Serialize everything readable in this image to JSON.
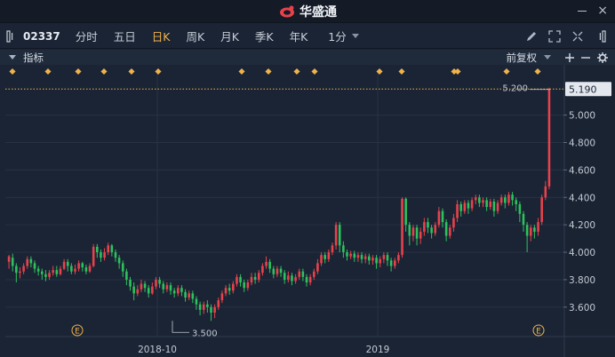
{
  "app": {
    "brand": "华盛通"
  },
  "toolbar": {
    "stock_code": "02337",
    "tabs": [
      {
        "label": "分时",
        "active": false
      },
      {
        "label": "五日",
        "active": false
      },
      {
        "label": "日K",
        "active": true
      },
      {
        "label": "周K",
        "active": false
      },
      {
        "label": "月K",
        "active": false
      },
      {
        "label": "季K",
        "active": false
      },
      {
        "label": "年K",
        "active": false
      }
    ],
    "interval": "1分"
  },
  "indicator_bar": {
    "label": "指标",
    "adjust": "前复权"
  },
  "colors": {
    "up": "#e8424b",
    "down": "#2ec25e",
    "accent": "#f0b24a",
    "background": "#1b2434"
  },
  "chart_data": {
    "type": "candlestick",
    "ylim": [
      3.45,
      5.25
    ],
    "y_ticks": [
      "5.190",
      "5.000",
      "4.800",
      "4.600",
      "4.400",
      "4.200",
      "4.000",
      "3.800",
      "3.600"
    ],
    "x_labels": [
      "2018-10",
      "2019"
    ],
    "last_price": "5.190",
    "max_label": "5.200",
    "min_label": "3.500",
    "event_markers": [
      "E",
      "E"
    ],
    "candles": [
      [
        3.93,
        3.97,
        3.88,
        3.98
      ],
      [
        3.96,
        3.9,
        3.86,
        3.99
      ],
      [
        3.9,
        3.85,
        3.78,
        3.92
      ],
      [
        3.85,
        3.86,
        3.81,
        3.89
      ],
      [
        3.86,
        3.9,
        3.84,
        3.92
      ],
      [
        3.9,
        3.95,
        3.88,
        3.97
      ],
      [
        3.95,
        3.92,
        3.89,
        3.97
      ],
      [
        3.92,
        3.88,
        3.85,
        3.94
      ],
      [
        3.88,
        3.86,
        3.83,
        3.9
      ],
      [
        3.86,
        3.84,
        3.8,
        3.88
      ],
      [
        3.84,
        3.82,
        3.79,
        3.87
      ],
      [
        3.82,
        3.85,
        3.8,
        3.87
      ],
      [
        3.85,
        3.87,
        3.83,
        3.9
      ],
      [
        3.87,
        3.84,
        3.82,
        3.9
      ],
      [
        3.84,
        3.88,
        3.83,
        3.9
      ],
      [
        3.88,
        3.93,
        3.87,
        3.95
      ],
      [
        3.93,
        3.9,
        3.86,
        3.95
      ],
      [
        3.9,
        3.86,
        3.84,
        3.92
      ],
      [
        3.86,
        3.88,
        3.84,
        3.91
      ],
      [
        3.88,
        3.92,
        3.86,
        3.94
      ],
      [
        3.92,
        3.89,
        3.86,
        3.93
      ],
      [
        3.89,
        3.86,
        3.84,
        3.91
      ],
      [
        3.86,
        3.9,
        3.85,
        3.92
      ],
      [
        3.9,
        4.04,
        3.89,
        4.06
      ],
      [
        4.04,
        4.0,
        3.96,
        4.06
      ],
      [
        4.0,
        3.96,
        3.93,
        4.02
      ],
      [
        3.96,
        4.0,
        3.94,
        4.03
      ],
      [
        4.0,
        4.05,
        3.98,
        4.07
      ],
      [
        4.05,
        4.0,
        3.97,
        4.06
      ],
      [
        4.0,
        3.96,
        3.93,
        4.02
      ],
      [
        3.96,
        3.92,
        3.88,
        3.98
      ],
      [
        3.92,
        3.86,
        3.82,
        3.94
      ],
      [
        3.86,
        3.8,
        3.76,
        3.88
      ],
      [
        3.8,
        3.75,
        3.72,
        3.82
      ],
      [
        3.75,
        3.7,
        3.65,
        3.78
      ],
      [
        3.7,
        3.73,
        3.68,
        3.76
      ],
      [
        3.73,
        3.77,
        3.71,
        3.8
      ],
      [
        3.77,
        3.74,
        3.71,
        3.79
      ],
      [
        3.74,
        3.7,
        3.67,
        3.76
      ],
      [
        3.7,
        3.75,
        3.69,
        3.78
      ],
      [
        3.75,
        3.8,
        3.73,
        3.82
      ],
      [
        3.8,
        3.77,
        3.74,
        3.82
      ],
      [
        3.77,
        3.73,
        3.7,
        3.79
      ],
      [
        3.73,
        3.76,
        3.71,
        3.78
      ],
      [
        3.76,
        3.72,
        3.69,
        3.78
      ],
      [
        3.72,
        3.7,
        3.67,
        3.74
      ],
      [
        3.7,
        3.74,
        3.68,
        3.76
      ],
      [
        3.74,
        3.71,
        3.68,
        3.76
      ],
      [
        3.71,
        3.67,
        3.64,
        3.73
      ],
      [
        3.67,
        3.7,
        3.65,
        3.72
      ],
      [
        3.7,
        3.66,
        3.63,
        3.72
      ],
      [
        3.66,
        3.62,
        3.58,
        3.68
      ],
      [
        3.62,
        3.58,
        3.54,
        3.64
      ],
      [
        3.58,
        3.62,
        3.55,
        3.64
      ],
      [
        3.62,
        3.6,
        3.56,
        3.65
      ],
      [
        3.6,
        3.56,
        3.5,
        3.62
      ],
      [
        3.56,
        3.6,
        3.52,
        3.62
      ],
      [
        3.6,
        3.65,
        3.58,
        3.67
      ],
      [
        3.65,
        3.7,
        3.63,
        3.72
      ],
      [
        3.7,
        3.74,
        3.68,
        3.76
      ],
      [
        3.74,
        3.72,
        3.69,
        3.77
      ],
      [
        3.72,
        3.77,
        3.7,
        3.79
      ],
      [
        3.77,
        3.82,
        3.75,
        3.84
      ],
      [
        3.82,
        3.78,
        3.75,
        3.84
      ],
      [
        3.78,
        3.74,
        3.71,
        3.8
      ],
      [
        3.74,
        3.78,
        3.72,
        3.8
      ],
      [
        3.78,
        3.82,
        3.76,
        3.85
      ],
      [
        3.82,
        3.8,
        3.77,
        3.85
      ],
      [
        3.8,
        3.85,
        3.78,
        3.87
      ],
      [
        3.85,
        3.9,
        3.83,
        3.92
      ],
      [
        3.9,
        3.93,
        3.88,
        3.97
      ],
      [
        3.93,
        3.88,
        3.85,
        3.95
      ],
      [
        3.88,
        3.84,
        3.81,
        3.9
      ],
      [
        3.84,
        3.88,
        3.82,
        3.9
      ],
      [
        3.88,
        3.85,
        3.82,
        3.9
      ],
      [
        3.85,
        3.8,
        3.77,
        3.87
      ],
      [
        3.8,
        3.83,
        3.78,
        3.86
      ],
      [
        3.83,
        3.79,
        3.76,
        3.85
      ],
      [
        3.79,
        3.82,
        3.77,
        3.84
      ],
      [
        3.82,
        3.86,
        3.8,
        3.88
      ],
      [
        3.86,
        3.82,
        3.79,
        3.88
      ],
      [
        3.82,
        3.78,
        3.75,
        3.84
      ],
      [
        3.78,
        3.82,
        3.76,
        3.84
      ],
      [
        3.82,
        3.86,
        3.8,
        3.88
      ],
      [
        3.86,
        3.92,
        3.84,
        3.95
      ],
      [
        3.92,
        3.98,
        3.9,
        4.0
      ],
      [
        3.98,
        3.95,
        3.92,
        4.0
      ],
      [
        3.95,
        4.0,
        3.93,
        4.02
      ],
      [
        4.0,
        4.05,
        3.98,
        4.07
      ],
      [
        4.05,
        4.2,
        4.02,
        4.22
      ],
      [
        4.2,
        4.05,
        4.0,
        4.22
      ],
      [
        4.05,
        4.0,
        3.96,
        4.08
      ],
      [
        4.0,
        3.97,
        3.94,
        4.02
      ],
      [
        3.97,
        3.99,
        3.95,
        4.01
      ],
      [
        3.99,
        3.96,
        3.93,
        4.01
      ],
      [
        3.96,
        3.98,
        3.93,
        4.0
      ],
      [
        3.98,
        3.95,
        3.92,
        4.0
      ],
      [
        3.95,
        3.97,
        3.92,
        3.99
      ],
      [
        3.97,
        3.94,
        3.91,
        3.99
      ],
      [
        3.94,
        3.96,
        3.91,
        3.98
      ],
      [
        3.96,
        3.92,
        3.88,
        3.98
      ],
      [
        3.92,
        3.95,
        3.89,
        3.97
      ],
      [
        3.95,
        3.98,
        3.92,
        4.0
      ],
      [
        3.98,
        3.94,
        3.9,
        4.0
      ],
      [
        3.94,
        3.9,
        3.86,
        3.96
      ],
      [
        3.9,
        3.94,
        3.88,
        3.96
      ],
      [
        3.94,
        3.98,
        3.92,
        4.0
      ],
      [
        3.98,
        4.39,
        3.96,
        4.4
      ],
      [
        4.39,
        4.2,
        4.15,
        4.4
      ],
      [
        4.2,
        4.12,
        4.05,
        4.22
      ],
      [
        4.12,
        4.18,
        4.08,
        4.2
      ],
      [
        4.18,
        4.1,
        4.05,
        4.2
      ],
      [
        4.1,
        4.15,
        4.06,
        4.18
      ],
      [
        4.15,
        4.22,
        4.12,
        4.25
      ],
      [
        4.22,
        4.18,
        4.14,
        4.25
      ],
      [
        4.18,
        4.14,
        4.1,
        4.2
      ],
      [
        4.14,
        4.2,
        4.12,
        4.22
      ],
      [
        4.2,
        4.3,
        4.18,
        4.33
      ],
      [
        4.3,
        4.22,
        4.18,
        4.32
      ],
      [
        4.22,
        4.12,
        4.08,
        4.24
      ],
      [
        4.12,
        4.18,
        4.1,
        4.2
      ],
      [
        4.18,
        4.25,
        4.15,
        4.28
      ],
      [
        4.25,
        4.35,
        4.22,
        4.38
      ],
      [
        4.35,
        4.3,
        4.26,
        4.37
      ],
      [
        4.3,
        4.36,
        4.28,
        4.38
      ],
      [
        4.36,
        4.32,
        4.28,
        4.38
      ],
      [
        4.32,
        4.38,
        4.3,
        4.4
      ],
      [
        4.38,
        4.4,
        4.35,
        4.42
      ],
      [
        4.4,
        4.36,
        4.33,
        4.42
      ],
      [
        4.36,
        4.38,
        4.33,
        4.4
      ],
      [
        4.38,
        4.33,
        4.3,
        4.4
      ],
      [
        4.33,
        4.37,
        4.31,
        4.39
      ],
      [
        4.37,
        4.3,
        4.26,
        4.39
      ],
      [
        4.3,
        4.36,
        4.28,
        4.38
      ],
      [
        4.36,
        4.4,
        4.34,
        4.42
      ],
      [
        4.4,
        4.36,
        4.32,
        4.42
      ],
      [
        4.36,
        4.42,
        4.34,
        4.44
      ],
      [
        4.42,
        4.38,
        4.34,
        4.44
      ],
      [
        4.38,
        4.35,
        4.3,
        4.4
      ],
      [
        4.35,
        4.28,
        4.22,
        4.37
      ],
      [
        4.28,
        4.2,
        4.15,
        4.3
      ],
      [
        4.2,
        4.12,
        4.0,
        4.22
      ],
      [
        4.12,
        4.18,
        4.08,
        4.2
      ],
      [
        4.18,
        4.15,
        4.1,
        4.2
      ],
      [
        4.15,
        4.22,
        4.12,
        4.25
      ],
      [
        4.22,
        4.4,
        4.2,
        4.42
      ],
      [
        4.4,
        4.48,
        4.38,
        4.52
      ],
      [
        4.48,
        5.19,
        4.46,
        5.2
      ]
    ]
  }
}
